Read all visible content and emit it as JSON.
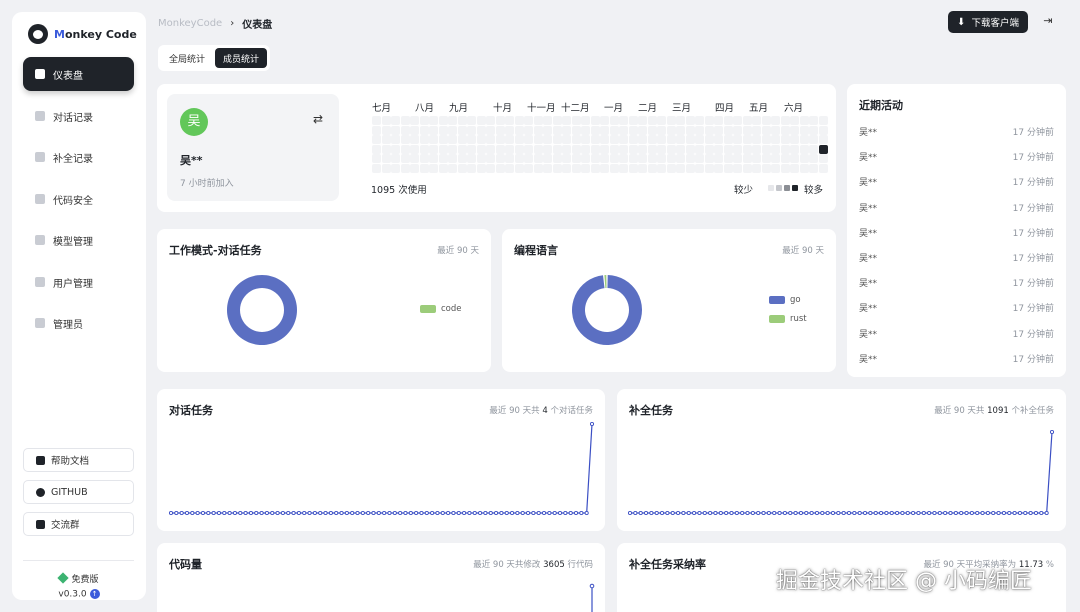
{
  "app": {
    "name_first": "M",
    "name_rest": "onkey Code"
  },
  "sidebar": {
    "items": [
      {
        "label": "仪表盘",
        "active": true
      },
      {
        "label": "对话记录"
      },
      {
        "label": "补全记录"
      },
      {
        "label": "代码安全"
      },
      {
        "label": "模型管理"
      },
      {
        "label": "用户管理"
      },
      {
        "label": "管理员"
      }
    ],
    "links": [
      {
        "label": "帮助文档"
      },
      {
        "label": "GITHUB"
      },
      {
        "label": "交流群"
      }
    ],
    "plan": "免费版",
    "version": "v0.3.0"
  },
  "header": {
    "breadcrumb_root": "MonkeyCode",
    "breadcrumb_sep": "›",
    "breadcrumb_current": "仪表盘",
    "download_label": "下载客户端"
  },
  "tabs": [
    {
      "label": "全局统计",
      "active": false
    },
    {
      "label": "成员统计",
      "active": true
    }
  ],
  "profile": {
    "avatar_char": "吴",
    "name": "吴**",
    "joined": "7 小时前加入",
    "swap_icon": "⇄"
  },
  "heatmap": {
    "months": [
      "七月",
      "八月",
      "九月",
      "十月",
      "十一月",
      "十二月",
      "一月",
      "二月",
      "三月",
      "四月",
      "五月",
      "六月"
    ],
    "usage": "1095 次使用",
    "less": "较少",
    "more": "较多",
    "levels": [
      "#e6e7ea",
      "#c4c6cb",
      "#8b8e94",
      "#1f2329"
    ]
  },
  "activity": {
    "title": "近期活动",
    "rows": [
      {
        "user": "吴**",
        "time": "17 分钟前"
      },
      {
        "user": "吴**",
        "time": "17 分钟前"
      },
      {
        "user": "吴**",
        "time": "17 分钟前"
      },
      {
        "user": "吴**",
        "time": "17 分钟前"
      },
      {
        "user": "吴**",
        "time": "17 分钟前"
      },
      {
        "user": "吴**",
        "time": "17 分钟前"
      },
      {
        "user": "吴**",
        "time": "17 分钟前"
      },
      {
        "user": "吴**",
        "time": "17 分钟前"
      },
      {
        "user": "吴**",
        "time": "17 分钟前"
      },
      {
        "user": "吴**",
        "time": "17 分钟前"
      }
    ]
  },
  "work_mode": {
    "title": "工作模式-对话任务",
    "sub": "最近 90 天",
    "legend": [
      {
        "label": "code",
        "color": "#9ccc7a"
      }
    ]
  },
  "language": {
    "title": "编程语言",
    "sub": "最近 90 天",
    "legend": [
      {
        "label": "go",
        "color": "#5b6fc2"
      },
      {
        "label": "rust",
        "color": "#9ccc7a"
      }
    ]
  },
  "chat_tasks": {
    "title": "对话任务",
    "sub_pre": "最近 90 天共",
    "sub_num": "4",
    "sub_post": "个对话任务"
  },
  "completion_tasks": {
    "title": "补全任务",
    "sub_pre": "最近 90 天共",
    "sub_num": "1091",
    "sub_post": "个补全任务"
  },
  "code_lines": {
    "title": "代码量",
    "sub_pre": "最近 90 天共修改",
    "sub_num": "3605",
    "sub_post": "行代码"
  },
  "acceptance": {
    "title": "补全任务采纳率",
    "sub_pre": "最近 90 天平均采纳率为",
    "sub_num": "11.73",
    "sub_post": "%"
  },
  "watermark": "掘金技术社区 @ 小码编匠",
  "chart_data": [
    {
      "type": "pie",
      "title": "工作模式-对话任务",
      "labels": [
        "code"
      ],
      "values": [
        100
      ],
      "colors": [
        "#5b6fc2"
      ]
    },
    {
      "type": "pie",
      "title": "编程语言",
      "labels": [
        "go",
        "rust"
      ],
      "values": [
        98.5,
        1.5
      ],
      "colors": [
        "#5b6fc2",
        "#9ccc7a"
      ]
    },
    {
      "type": "line",
      "title": "对话任务",
      "points": 80,
      "values_last": 4,
      "color": "#3b4fc4"
    },
    {
      "type": "line",
      "title": "补全任务",
      "points": 80,
      "values_last": 1091,
      "color": "#3b4fc4"
    }
  ]
}
